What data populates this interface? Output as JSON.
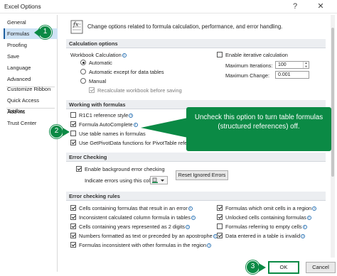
{
  "window": {
    "title": "Excel Options",
    "help_glyph": "?",
    "close_glyph": "✕"
  },
  "sidebar": {
    "items": [
      {
        "label": "General"
      },
      {
        "label": "Formulas",
        "active": true
      },
      {
        "label": "Proofing"
      },
      {
        "label": "Save"
      },
      {
        "label": "Language"
      },
      {
        "label": "Advanced"
      },
      {
        "label": "Customize Ribbon"
      },
      {
        "label": "Quick Access Toolbar"
      },
      {
        "label": "Add-ins"
      },
      {
        "label": "Trust Center"
      }
    ]
  },
  "intro": {
    "text": "Change options related to formula calculation, performance, and error handling.",
    "icon": "formula-options-icon"
  },
  "calculation": {
    "header": "Calculation options",
    "workbook_label": "Workbook Calculation",
    "radios": [
      {
        "label": "Automatic",
        "selected": true
      },
      {
        "label": "Automatic except for data tables",
        "selected": false
      },
      {
        "label": "Manual",
        "selected": false
      }
    ],
    "recalc_label": "Recalculate workbook before saving",
    "iterative_label": "Enable iterative calculation",
    "max_iterations_label": "Maximum Iterations:",
    "max_iterations_value": "100",
    "max_change_label": "Maximum Change:",
    "max_change_value": "0.001"
  },
  "working": {
    "header": "Working with formulas",
    "items": [
      {
        "label": "R1C1 reference style",
        "checked": false
      },
      {
        "label": "Formula AutoComplete",
        "checked": true
      },
      {
        "label": "Use table names in formulas",
        "checked": false
      },
      {
        "label": "Use GetPivotData functions for PivotTable referen",
        "checked": true
      }
    ]
  },
  "error_checking": {
    "header": "Error Checking",
    "enable_label": "Enable background error checking",
    "indicate_label": "Indicate errors using this color:",
    "reset_button": "Reset Ignored Errors"
  },
  "rules": {
    "header": "Error checking rules",
    "left": [
      {
        "label": "Cells containing formulas that result in an error",
        "checked": true
      },
      {
        "label": "Inconsistent calculated column formula in tables",
        "checked": true
      },
      {
        "label": "Cells containing years represented as 2 digits",
        "checked": true
      },
      {
        "label": "Numbers formatted as text or preceded by an apostrophe",
        "checked": true
      },
      {
        "label": "Formulas inconsistent with other formulas in the region",
        "checked": true
      }
    ],
    "right": [
      {
        "label": "Formulas which omit cells in a region",
        "checked": true
      },
      {
        "label": "Unlocked cells containing formulas",
        "checked": true
      },
      {
        "label": "Formulas referring to empty cells",
        "checked": false
      },
      {
        "label": "Data entered in a table is invalid",
        "checked": true
      }
    ]
  },
  "callout": {
    "text": "Uncheck this option to turn table formulas (structured references) off."
  },
  "badges": {
    "one": "1",
    "two": "2",
    "three": "3"
  },
  "footer": {
    "ok_label": "OK",
    "cancel_label": "Cancel"
  },
  "colors": {
    "accent_green": "#0b8a45",
    "selected_nav": "#cfe3f5",
    "section_bg": "#eceef1"
  }
}
